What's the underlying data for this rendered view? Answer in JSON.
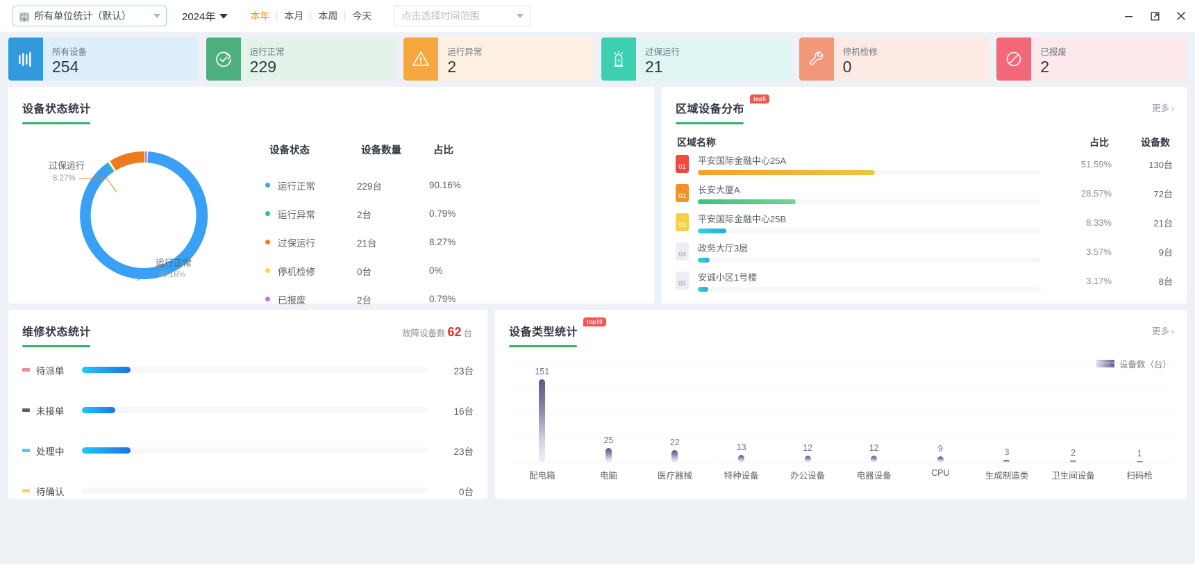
{
  "topbar": {
    "unit_select": {
      "value": "所有单位统计（默认）",
      "icon": "building-icon"
    },
    "year": "2024年",
    "range_tabs": [
      {
        "label": "本年",
        "active": true
      },
      {
        "label": "本月",
        "active": false
      },
      {
        "label": "本周",
        "active": false
      },
      {
        "label": "今天",
        "active": false
      }
    ],
    "date_range_placeholder": "点击选择时间范围",
    "window_controls": [
      "minimize-icon",
      "maximize-icon",
      "close-icon"
    ]
  },
  "kpis": [
    {
      "label": "所有设备",
      "value": "254",
      "icon": "bars-icon",
      "icon_bg": "#3399dd",
      "card_bg": "#ddeffa"
    },
    {
      "label": "运行正常",
      "value": "229",
      "icon": "check-refresh-icon",
      "icon_bg": "#4caf7d",
      "card_bg": "#e3f3e9"
    },
    {
      "label": "运行异常",
      "value": "2",
      "icon": "warning-icon",
      "icon_bg": "#f5a840",
      "card_bg": "#fdf0e0"
    },
    {
      "label": "过保运行",
      "value": "21",
      "icon": "alarm-icon",
      "icon_bg": "#3ccfb0",
      "card_bg": "#dff6f2"
    },
    {
      "label": "停机检修",
      "value": "0",
      "icon": "wrench-icon",
      "icon_bg": "#f3977a",
      "card_bg": "#fdeae4"
    },
    {
      "label": "已报废",
      "value": "2",
      "icon": "ban-icon",
      "icon_bg": "#f4697a",
      "card_bg": "#fde9ec"
    }
  ],
  "device_status": {
    "title": "设备状态统计",
    "columns": [
      "设备状态",
      "设备数量",
      "占比"
    ],
    "rows": [
      {
        "name": "运行正常",
        "count": "229台",
        "pct": "90.16%",
        "color": "#3aa0f5"
      },
      {
        "name": "运行异常",
        "count": "2台",
        "pct": "0.79%",
        "color": "#2fc28a"
      },
      {
        "name": "过保运行",
        "count": "21台",
        "pct": "8.27%",
        "color": "#f07a1e"
      },
      {
        "name": "停机检修",
        "count": "0台",
        "pct": "0%",
        "color": "#f7d64a"
      },
      {
        "name": "已报废",
        "count": "2台",
        "pct": "0.79%",
        "color": "#b779e8"
      }
    ],
    "donut_labels": [
      {
        "name": "过保运行",
        "pct": "8.27%"
      },
      {
        "name": "运行正常",
        "pct": "90.16%"
      }
    ],
    "chart_data": {
      "type": "pie",
      "title": "设备状态统计",
      "categories": [
        "运行正常",
        "运行异常",
        "过保运行",
        "停机检修",
        "已报废"
      ],
      "values": [
        229,
        2,
        21,
        0,
        2
      ],
      "percents": [
        90.16,
        0.79,
        8.27,
        0,
        0.79
      ],
      "colors": [
        "#3aa0f5",
        "#2fc28a",
        "#f07a1e",
        "#f7d64a",
        "#b779e8"
      ],
      "legend": "right-table"
    }
  },
  "area_distribution": {
    "title": "区域设备分布",
    "badge": "top5",
    "more": "更多",
    "columns": [
      "区域名称",
      "占比",
      "设备数"
    ],
    "rows": [
      {
        "rank": "01",
        "name": "平安国际金融中心25A",
        "pct": "51.59%",
        "count": "130台",
        "bar_pct": 51.59,
        "rank_bg": "#f04a3f",
        "bar_from": "#f5a02c",
        "bar_to": "#e8c83f"
      },
      {
        "rank": "02",
        "name": "长安大厦A",
        "pct": "28.57%",
        "count": "72台",
        "bar_pct": 28.57,
        "rank_bg": "#f0932b",
        "bar_from": "#3fc07f",
        "bar_to": "#6fd49a"
      },
      {
        "rank": "03",
        "name": "平安国际金融中心25B",
        "pct": "8.33%",
        "count": "21台",
        "bar_pct": 8.33,
        "rank_bg": "#f7d04a",
        "bar_from": "#2fd6d0",
        "bar_to": "#2aa8e8"
      },
      {
        "rank": "04",
        "name": "政务大厅3层",
        "pct": "3.57%",
        "count": "9台",
        "bar_pct": 3.4,
        "rank_bg": "#eceef1",
        "bar_from": "#2fd6d0",
        "bar_to": "#2aa8e8"
      },
      {
        "rank": "05",
        "name": "安诚小区1号楼",
        "pct": "3.17%",
        "count": "8台",
        "bar_pct": 3.1,
        "rank_bg": "#eceef1",
        "bar_from": "#2fd6d0",
        "bar_to": "#2aa8e8"
      }
    ],
    "chart_data": {
      "type": "bar",
      "title": "区域设备分布",
      "categories": [
        "平安国际金融中心25A",
        "长安大厦A",
        "平安国际金融中心25B",
        "政务大厅3层",
        "安诚小区1号楼"
      ],
      "values": [
        130,
        72,
        21,
        9,
        8
      ],
      "percents": [
        51.59,
        28.57,
        8.33,
        3.57,
        3.17
      ],
      "ylabel": "设备数",
      "orientation": "horizontal"
    }
  },
  "repair_status": {
    "title": "维修状态统计",
    "fault_label": "故障设备数",
    "fault_count": "62",
    "fault_unit": "台",
    "rows": [
      {
        "name": "待派单",
        "value": "23台",
        "num": 23,
        "bar_pct": 37.5,
        "sq": "#f08a94"
      },
      {
        "name": "未接单",
        "value": "16台",
        "num": 16,
        "bar_pct": 26.0,
        "sq": "#5a6168"
      },
      {
        "name": "处理中",
        "value": "23台",
        "num": 23,
        "bar_pct": 37.5,
        "sq": "#59c8ee"
      },
      {
        "name": "待确认",
        "value": "0台",
        "num": 0,
        "bar_pct": 0,
        "sq": "#f5d87a"
      }
    ],
    "chart_data": {
      "type": "bar",
      "title": "维修状态统计",
      "categories": [
        "待派单",
        "未接单",
        "处理中",
        "待确认"
      ],
      "values": [
        23,
        16,
        23,
        0
      ],
      "ylabel": "台",
      "orientation": "horizontal"
    }
  },
  "device_type": {
    "title": "设备类型统计",
    "badge": "top10",
    "more": "更多",
    "legend": "设备数（台）",
    "chart_data": {
      "type": "bar",
      "title": "设备类型统计",
      "categories": [
        "配电箱",
        "电脑",
        "医疗器械",
        "特种设备",
        "办公设备",
        "电器设备",
        "CPU",
        "生成制造类",
        "卫生间设备",
        "扫码枪"
      ],
      "values": [
        151,
        25,
        22,
        13,
        12,
        12,
        9,
        3,
        2,
        1
      ],
      "ylabel": "设备数（台）",
      "ylim": [
        0,
        160
      ],
      "grid": true,
      "legend_entries": [
        "设备数（台）"
      ]
    }
  }
}
